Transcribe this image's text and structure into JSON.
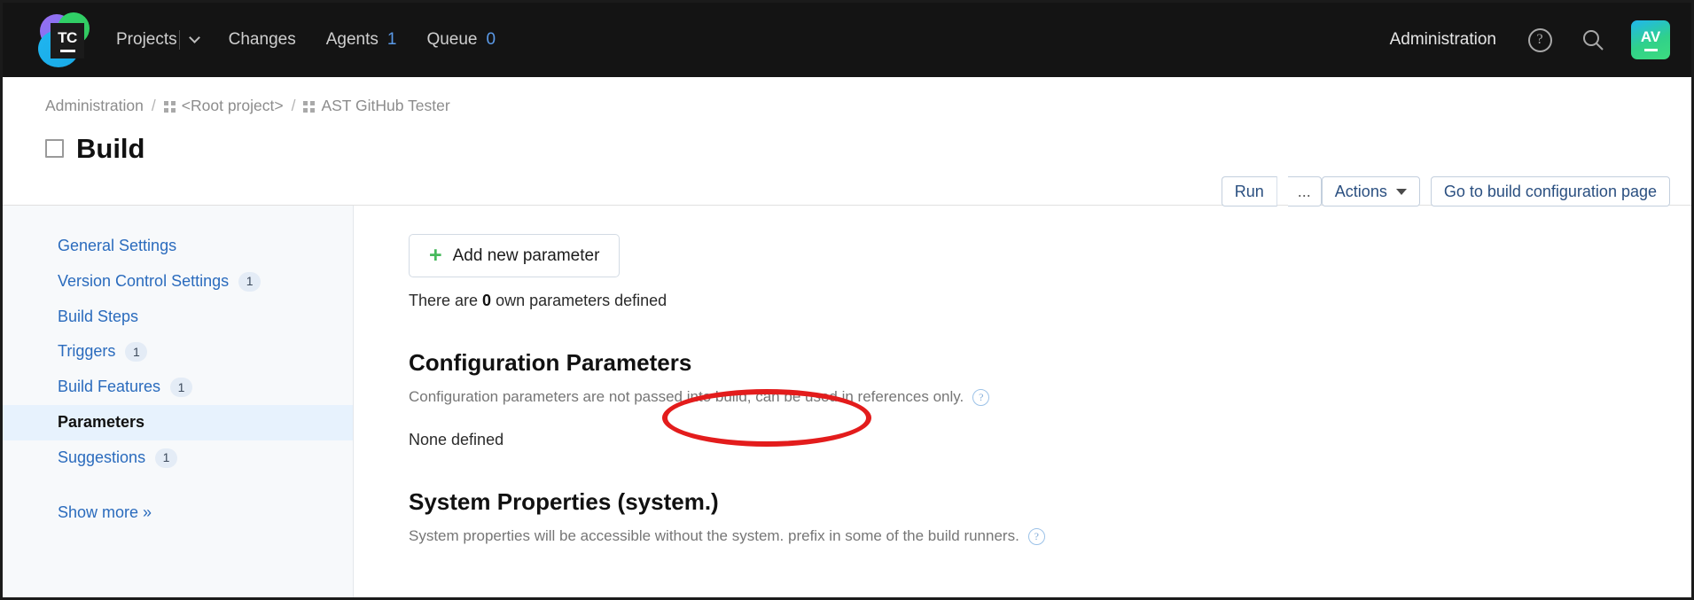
{
  "topnav": {
    "logo_text": "TC",
    "logo_name": "teamcity-logo",
    "items": [
      {
        "label": "Projects",
        "count": null,
        "has_dropdown": true
      },
      {
        "label": "Changes",
        "count": null,
        "has_dropdown": false
      },
      {
        "label": "Agents",
        "count": "1",
        "has_dropdown": false
      },
      {
        "label": "Queue",
        "count": "0",
        "has_dropdown": false
      }
    ],
    "administration_label": "Administration",
    "help_icon": "question-mark-icon",
    "search_icon": "search-icon",
    "avatar_initials": "AV"
  },
  "header": {
    "breadcrumb": [
      {
        "label": "Administration",
        "has_icon": false
      },
      {
        "label": "<Root project>",
        "has_icon": true
      },
      {
        "label": "AST GitHub Tester",
        "has_icon": true
      }
    ],
    "separator": "/",
    "page_title": "Build",
    "toolbar": {
      "run_label": "Run",
      "run_more_label": "...",
      "actions_label": "Actions",
      "goto_label": "Go to build configuration page"
    }
  },
  "sidebar": {
    "items": [
      {
        "label": "General Settings",
        "badge": null,
        "active": false
      },
      {
        "label": "Version Control Settings",
        "badge": "1",
        "active": false
      },
      {
        "label": "Build Steps",
        "badge": null,
        "active": false
      },
      {
        "label": "Triggers",
        "badge": "1",
        "active": false
      },
      {
        "label": "Build Features",
        "badge": "1",
        "active": false
      },
      {
        "label": "Parameters",
        "badge": null,
        "active": true
      },
      {
        "label": "Suggestions",
        "badge": "1",
        "active": false
      }
    ],
    "show_more_label": "Show more »"
  },
  "main": {
    "add_parameter_label": "Add new parameter",
    "add_parameter_icon": "plus-icon",
    "own_params_prefix": "There are ",
    "own_params_count": "0",
    "own_params_suffix": " own parameters defined",
    "sections": [
      {
        "title": "Configuration Parameters",
        "description": "Configuration parameters are not passed into build, can be used in references only.",
        "empty_text": "None defined"
      },
      {
        "title": "System Properties (system.)",
        "description": "System properties will be accessible without the system. prefix in some of the build runners.",
        "empty_text": ""
      }
    ]
  },
  "annotation": {
    "shape": "red-ellipse-highlight",
    "color": "#e31c1c",
    "target": "add-new-parameter-button"
  }
}
